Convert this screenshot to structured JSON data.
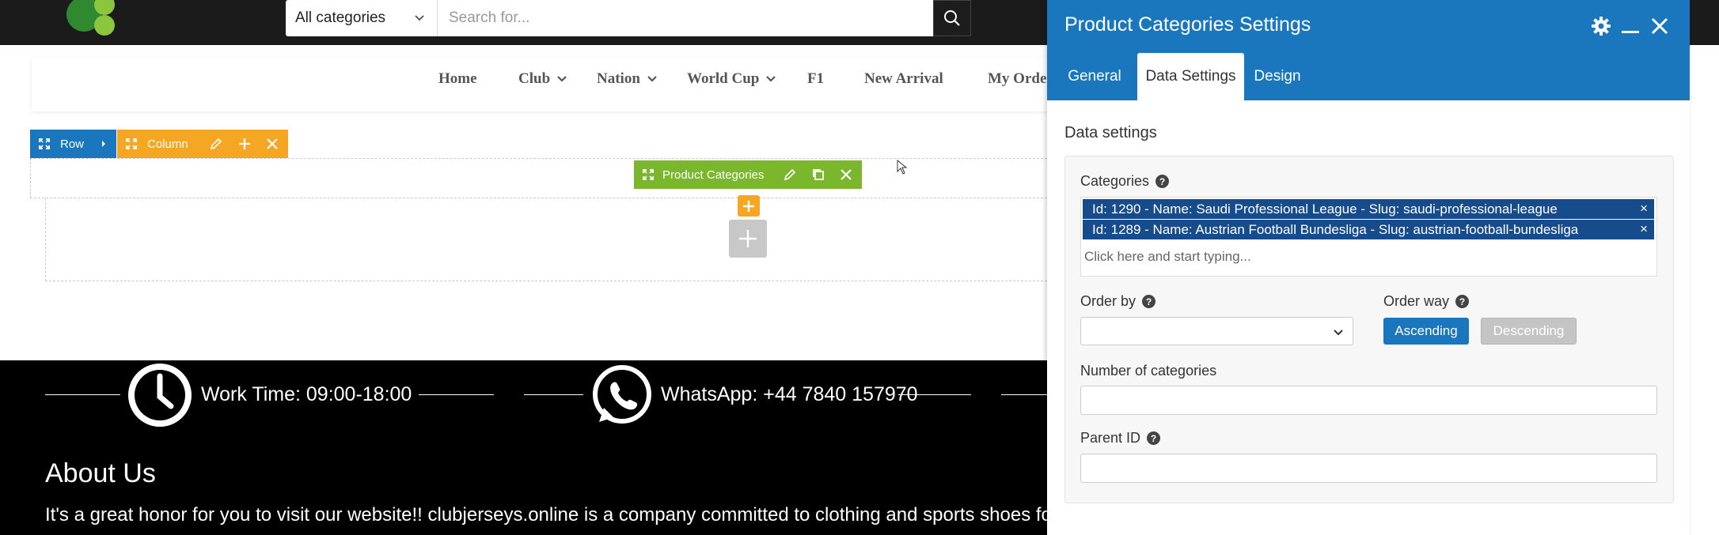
{
  "header": {
    "category_select": "All categories",
    "search_placeholder": "Search for..."
  },
  "nav": {
    "items": [
      "Home",
      "Club",
      "Nation",
      "World Cup",
      "F1",
      "New Arrival",
      "My Orde"
    ]
  },
  "builder": {
    "row_label": "Row",
    "column_label": "Column",
    "element_label": "Product Categories"
  },
  "footer": {
    "work_time": "Work Time: 09:00-18:00",
    "whatsapp": "WhatsApp: +44 7840 157970",
    "about_title": "About Us",
    "about_text": "It's a great honor for you to visit our website!! clubjerseys.online is a company committed to clothing and sports shoes for"
  },
  "panel": {
    "title": "Product Categories Settings",
    "tabs": [
      "General",
      "Data Settings",
      "Design"
    ],
    "active_tab": "Data Settings",
    "section_heading": "Data settings",
    "categories_label": "Categories",
    "selected_categories": [
      "Id: 1290 - Name: Saudi Professional League - Slug: saudi-professional-league",
      "Id: 1289 - Name: Austrian Football Bundesliga - Slug: austrian-football-bundesliga"
    ],
    "tag_remove": "×",
    "categories_placeholder": "Click here and start typing...",
    "order_by_label": "Order by",
    "order_by_value": "",
    "order_way_label": "Order way",
    "ascending": "Ascending",
    "descending": "Descending",
    "number_label": "Number of categories",
    "number_value": "",
    "parent_label": "Parent ID",
    "parent_value": ""
  },
  "colors": {
    "brand_blue": "#1a77bd",
    "column_orange": "#f5a623",
    "element_green": "#7bb72c",
    "tag_blue": "#174c8c"
  }
}
